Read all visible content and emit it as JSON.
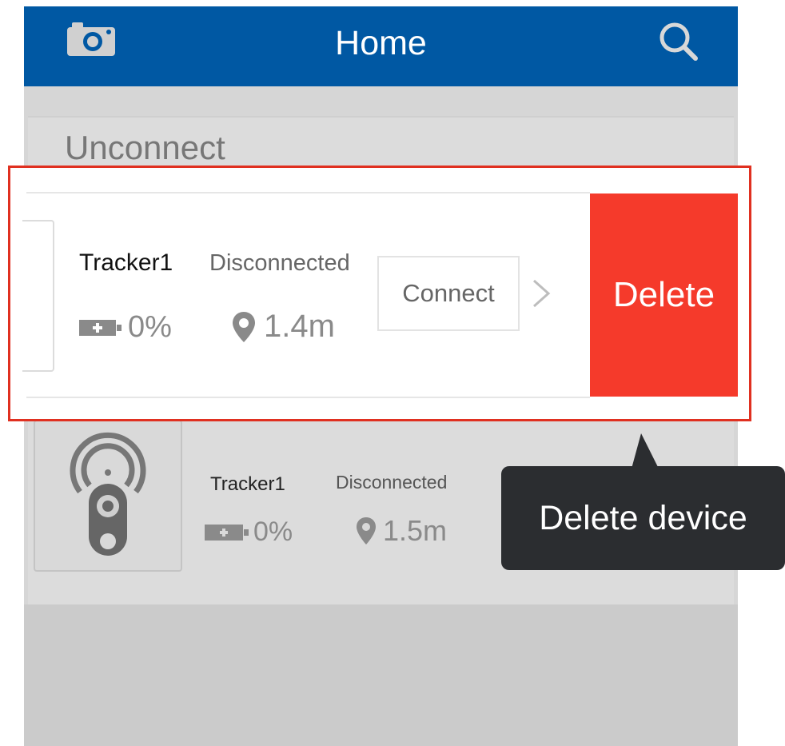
{
  "header": {
    "title": "Home",
    "left_icon": "camera-icon",
    "right_icon": "search-icon"
  },
  "section": {
    "title": "Unconnect"
  },
  "highlighted_device": {
    "name": "Tracker1",
    "status": "Disconnected",
    "battery": "0%",
    "distance": "1.4m",
    "connect_label": "Connect",
    "delete_label": "Delete"
  },
  "background_device": {
    "name": "Tracker1",
    "status": "Disconnected",
    "battery": "0%",
    "distance": "1.5m"
  },
  "tooltip": {
    "text": "Delete device"
  },
  "colors": {
    "header": "#0058a3",
    "delete": "#f53a2b",
    "highlight_border": "#e03020",
    "tooltip": "#2b2d30"
  }
}
